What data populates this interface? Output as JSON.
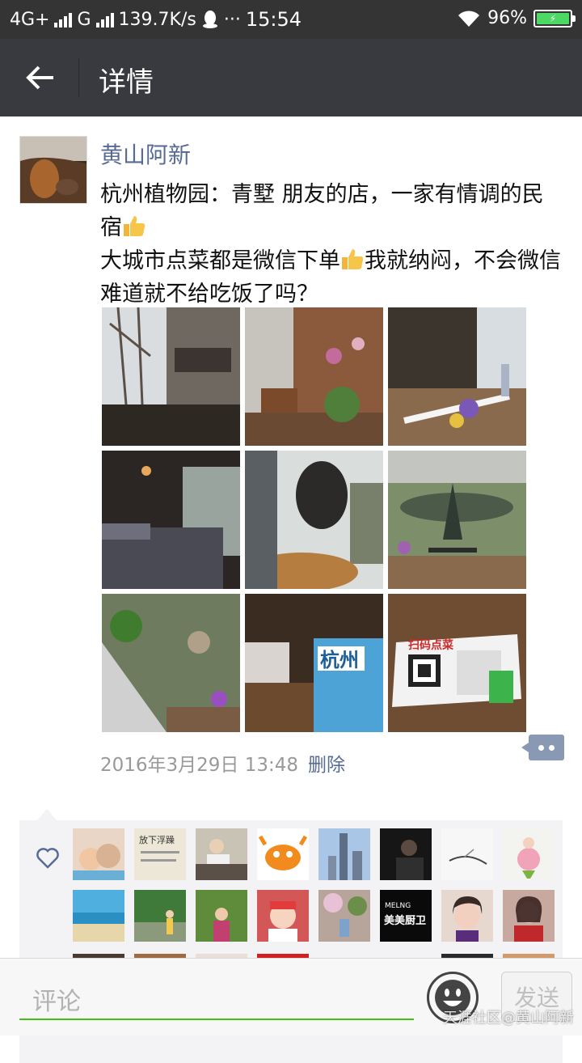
{
  "status_bar": {
    "network": "4G+",
    "network2": "G",
    "speed": "139.7K/s",
    "dots": "···",
    "time": "15:54",
    "battery": "96%"
  },
  "header": {
    "title": "详情"
  },
  "post": {
    "author": "黄山阿新",
    "text_line1": "杭州植物园：青墅 朋友的店，一家有情调的民宿",
    "text_line2a": "大城市点菜都是微信下单",
    "text_line2b": "我就纳闷，不会微信难道就不给吃饭了吗？",
    "time": "2016年3月29日 13:48",
    "delete_label": "删除",
    "photo_texts": {
      "book": "杭州",
      "menu": "扫码点菜"
    }
  },
  "likes": {
    "avatar_texts": {
      "calligraphy": "放下浮躁",
      "brand": "美美厨卫",
      "brand_small": "MELNG"
    }
  },
  "comment_bar": {
    "placeholder": "评论",
    "send_label": "发送"
  },
  "watermark": "天涯社区@黄山阿新",
  "colors": {
    "link": "#576b95",
    "header_bg": "#393a3f",
    "accent": "#45c01a"
  }
}
